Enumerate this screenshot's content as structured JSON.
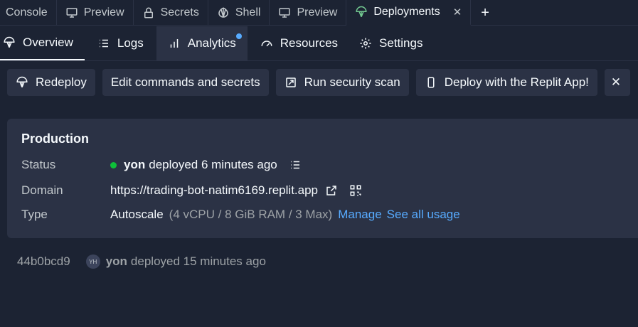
{
  "tabs": [
    {
      "label": "Console",
      "icon": "terminal-icon"
    },
    {
      "label": "Preview",
      "icon": "monitor-icon"
    },
    {
      "label": "Secrets",
      "icon": "lock-icon"
    },
    {
      "label": "Shell",
      "icon": "shell-icon"
    },
    {
      "label": "Preview",
      "icon": "monitor-icon"
    },
    {
      "label": "Deployments",
      "icon": "deployments-icon",
      "active": true
    }
  ],
  "subtabs": [
    {
      "label": "Overview",
      "icon": "deployments-icon",
      "active": true
    },
    {
      "label": "Logs",
      "icon": "list-icon"
    },
    {
      "label": "Analytics",
      "icon": "bar-chart-icon",
      "badge": true
    },
    {
      "label": "Resources",
      "icon": "gauge-icon"
    },
    {
      "label": "Settings",
      "icon": "gear-icon"
    }
  ],
  "actions": {
    "redeploy": "Redeploy",
    "edit": "Edit commands and secrets",
    "scan": "Run security scan",
    "app": "Deploy with the Replit App!"
  },
  "production": {
    "title": "Production",
    "status_label": "Status",
    "status_user": "yon",
    "status_text": "deployed 6 minutes ago",
    "domain_label": "Domain",
    "domain": "https://trading-bot-natim6169.replit.app",
    "type_label": "Type",
    "type": "Autoscale",
    "type_detail": "(4 vCPU / 8 GiB RAM / 3 Max)",
    "manage": "Manage",
    "see_usage": "See all usage"
  },
  "history": {
    "commit": "44b0bcd9",
    "avatar_initials": "YH",
    "user": "yon",
    "text": "deployed 15 minutes ago"
  },
  "colors": {
    "background": "#1c2333",
    "surface": "#2b3245",
    "accent": "#57abff",
    "status_green": "#0ebf39",
    "deployments_icon": "#73c991"
  }
}
